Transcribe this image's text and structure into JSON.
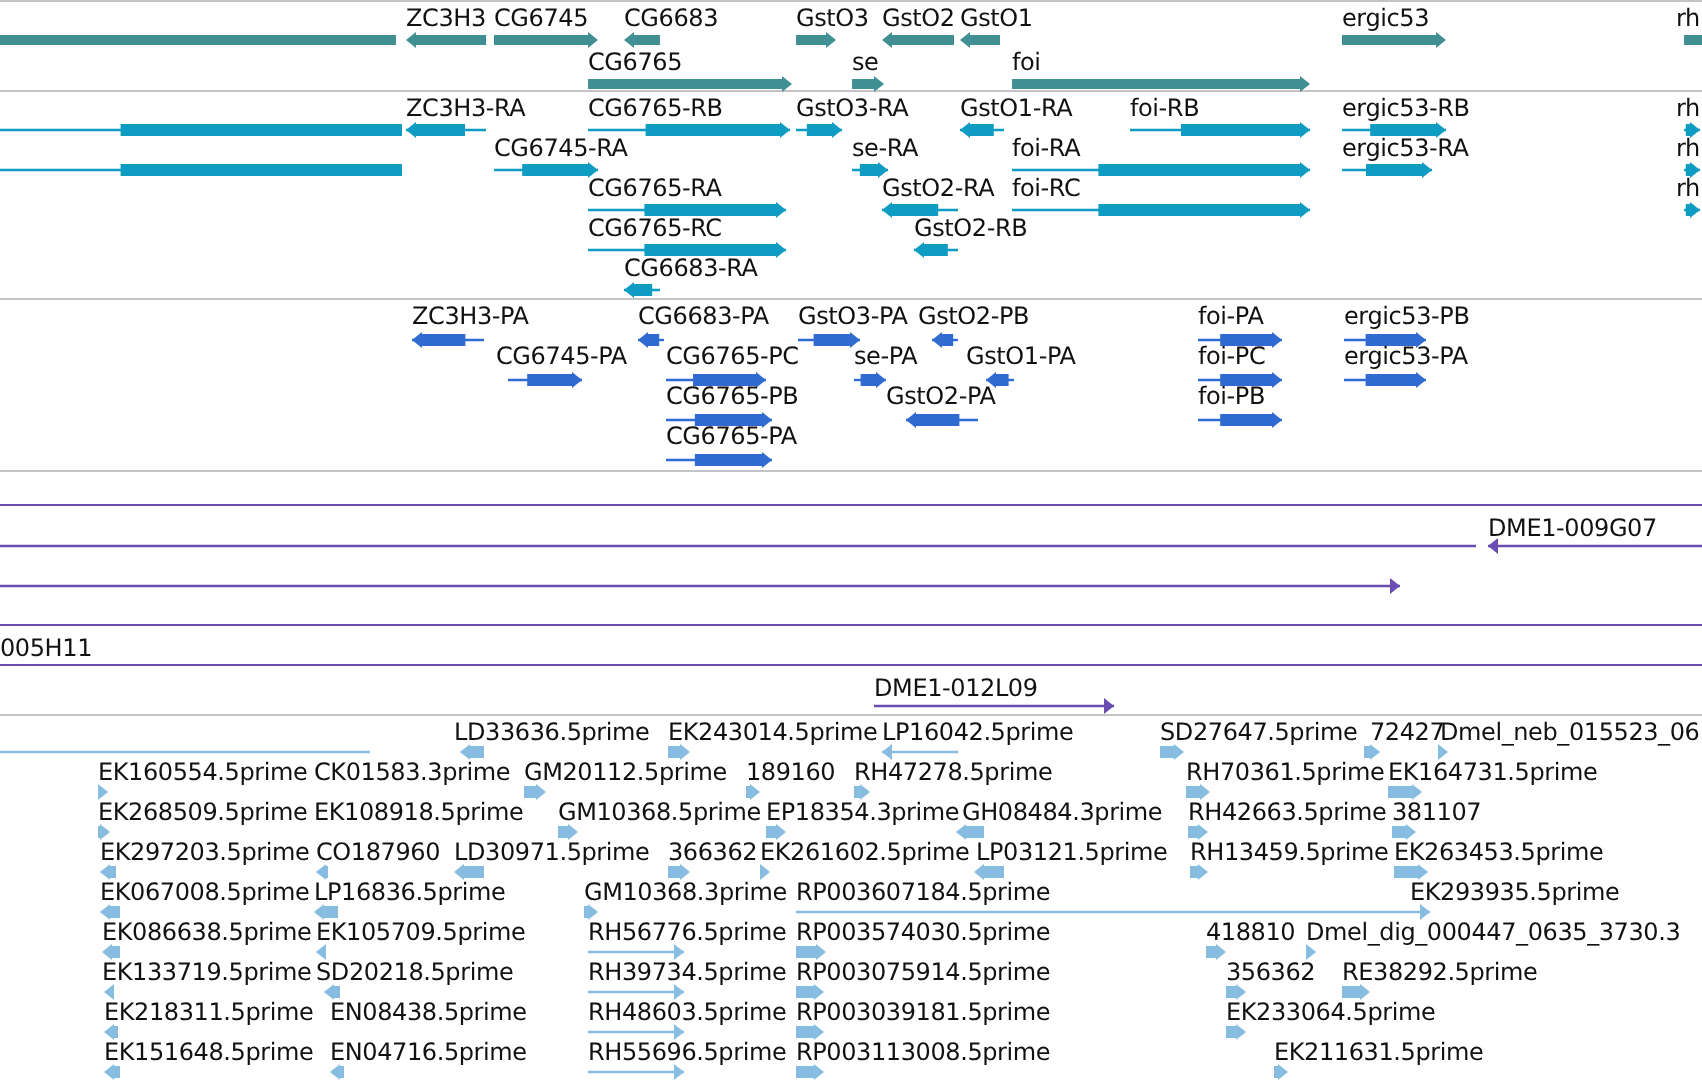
{
  "tracks": [
    {
      "kind": "gene",
      "rows": [
        {
          "features": [
            {
              "reverse": true
            },
            {
              "label": "ZC3H3",
              "reverse": true
            },
            {
              "label": "CG6745",
              "reverse": false
            },
            {
              "label": "CG6683",
              "reverse": true
            },
            {
              "label": "GstO3",
              "reverse": false
            },
            {
              "label": "GstO2",
              "reverse": true
            },
            {
              "label": "GstO1",
              "reverse": true
            },
            {
              "label": "ergic53",
              "reverse": false
            },
            {
              "label": "rh",
              "reverse": false
            }
          ]
        },
        {
          "features": [
            {
              "label": "CG6765",
              "reverse": false
            },
            {
              "label": "se",
              "reverse": false
            },
            {
              "label": "foi",
              "reverse": false
            }
          ]
        }
      ]
    },
    {
      "kind": "transcript",
      "rows": [
        {
          "features": [
            {
              "reverse": true
            },
            {
              "label": "ZC3H3-RA",
              "reverse": true
            },
            {
              "label": "CG6765-RB",
              "reverse": false
            },
            {
              "label": "GstO3-RA",
              "reverse": false
            },
            {
              "label": "GstO1-RA",
              "reverse": true
            },
            {
              "label": "foi-RB",
              "reverse": false
            },
            {
              "label": "ergic53-RB",
              "reverse": false
            },
            {
              "label": "rh",
              "reverse": false
            }
          ]
        },
        {
          "features": [
            {
              "reverse": true
            },
            {
              "label": "CG6745-RA",
              "reverse": false
            },
            {
              "label": "se-RA",
              "reverse": false
            },
            {
              "label": "foi-RA",
              "reverse": false
            },
            {
              "label": "ergic53-RA",
              "reverse": false
            },
            {
              "label": "rh",
              "reverse": false
            }
          ]
        },
        {
          "features": [
            {
              "label": "CG6765-RA",
              "reverse": false
            },
            {
              "label": "GstO2-RA",
              "reverse": true
            },
            {
              "label": "foi-RC",
              "reverse": false
            },
            {
              "label": "rh",
              "reverse": false
            }
          ]
        },
        {
          "features": [
            {
              "label": "CG6765-RC",
              "reverse": false
            },
            {
              "label": "GstO2-RB",
              "reverse": true
            }
          ]
        },
        {
          "features": [
            {
              "label": "CG6683-RA",
              "reverse": true
            }
          ]
        }
      ]
    },
    {
      "kind": "protein",
      "rows": [
        {
          "features": [
            {
              "label": "ZC3H3-PA",
              "reverse": true
            },
            {
              "label": "CG6683-PA",
              "reverse": true
            },
            {
              "label": "GstO3-PA",
              "reverse": false
            },
            {
              "label": "GstO2-PB",
              "reverse": true
            },
            {
              "label": "foi-PA",
              "reverse": false
            },
            {
              "label": "ergic53-PB",
              "reverse": false
            }
          ]
        },
        {
          "features": [
            {
              "label": "CG6745-PA",
              "reverse": false
            },
            {
              "label": "CG6765-PC",
              "reverse": false
            },
            {
              "label": "se-PA",
              "reverse": false
            },
            {
              "label": "GstO1-PA",
              "reverse": true
            },
            {
              "label": "foi-PC",
              "reverse": false
            },
            {
              "label": "ergic53-PA",
              "reverse": false
            }
          ]
        },
        {
          "features": [
            {
              "label": "CG6765-PB",
              "reverse": false
            },
            {
              "label": "GstO2-PA",
              "reverse": true
            },
            {
              "label": "foi-PB",
              "reverse": false
            }
          ]
        },
        {
          "features": [
            {
              "label": "CG6765-PA",
              "reverse": false
            }
          ]
        }
      ]
    },
    {
      "kind": "clone",
      "rows": [
        {
          "spanning": true
        },
        {
          "spanning": false,
          "features": [
            {
              "reverse": true
            },
            {
              "label": "DME1-009G07",
              "reverse": true
            }
          ]
        },
        {
          "spanning": false,
          "features": [
            {
              "reverse": false
            }
          ]
        },
        {
          "spanning": true
        },
        {
          "spanning": true,
          "features": [
            {
              "label": "005H11"
            }
          ]
        },
        {
          "spanning": false,
          "features": [
            {
              "label": "DME1-012L09",
              "reverse": false
            }
          ]
        }
      ]
    },
    {
      "kind": "est",
      "rows": [
        {
          "features": [
            {
              "reverse": true
            },
            {
              "label": "LD33636.5prime",
              "reverse": true
            },
            {
              "label": "EK243014.5prime",
              "reverse": false
            },
            {
              "label": "LP16042.5prime",
              "reverse": true
            },
            {
              "label": "SD27647.5prime",
              "reverse": false
            },
            {
              "label": "72427",
              "reverse": false
            },
            {
              "label": "Dmel_neb_015523_06",
              "reverse": false
            }
          ]
        },
        {
          "features": [
            {
              "label": "EK160554.5prime",
              "reverse": false
            },
            {
              "label": "CK01583.3prime"
            },
            {
              "label": "GM20112.5prime",
              "reverse": false
            },
            {
              "label": "189160",
              "reverse": false
            },
            {
              "label": "RH47278.5prime",
              "reverse": false
            },
            {
              "label": "RH70361.5prime",
              "reverse": false
            },
            {
              "label": "EK164731.5prime",
              "reverse": false
            }
          ]
        },
        {
          "features": [
            {
              "label": "EK268509.5prime",
              "reverse": false
            },
            {
              "label": "EK108918.5prime"
            },
            {
              "label": "GM10368.5prime",
              "reverse": false
            },
            {
              "label": "EP18354.3prime",
              "reverse": false
            },
            {
              "label": "GH08484.3prime",
              "reverse": true
            },
            {
              "label": "RH42663.5prime",
              "reverse": false
            },
            {
              "label": "381107",
              "reverse": false
            }
          ]
        },
        {
          "features": [
            {
              "label": "EK297203.5prime",
              "reverse": true
            },
            {
              "label": "CO187960",
              "reverse": true
            },
            {
              "label": "LD30971.5prime",
              "reverse": true
            },
            {
              "label": "366362",
              "reverse": false
            },
            {
              "label": "EK261602.5prime",
              "reverse": false
            },
            {
              "label": "LP03121.5prime",
              "reverse": true
            },
            {
              "label": "RH13459.5prime",
              "reverse": false
            },
            {
              "label": "EK263453.5prime",
              "reverse": false
            }
          ]
        },
        {
          "features": [
            {
              "label": "EK067008.5prime",
              "reverse": true
            },
            {
              "label": "LP16836.5prime",
              "reverse": true
            },
            {
              "label": "GM10368.3prime",
              "reverse": false
            },
            {
              "label": "RP003607184.5prime",
              "reverse": false
            },
            {
              "label": "EK293935.5prime"
            }
          ]
        },
        {
          "features": [
            {
              "label": "EK086638.5prime",
              "reverse": true
            },
            {
              "label": "EK105709.5prime",
              "reverse": true
            },
            {
              "label": "RH56776.5prime",
              "reverse": false
            },
            {
              "label": "RP003574030.5prime",
              "reverse": false
            },
            {
              "label": "418810",
              "reverse": false
            },
            {
              "label": "Dmel_dig_000447_0635_3730.3",
              "reverse": false
            }
          ]
        },
        {
          "features": [
            {
              "label": "EK133719.5prime",
              "reverse": true
            },
            {
              "label": "SD20218.5prime",
              "reverse": true
            },
            {
              "label": "RH39734.5prime",
              "reverse": false
            },
            {
              "label": "RP003075914.5prime",
              "reverse": false
            },
            {
              "label": "356362",
              "reverse": false
            },
            {
              "label": "RE38292.5prime",
              "reverse": false
            }
          ]
        },
        {
          "features": [
            {
              "label": "EK218311.5prime",
              "reverse": true
            },
            {
              "label": "EN08438.5prime"
            },
            {
              "label": "RH48603.5prime",
              "reverse": false
            },
            {
              "label": "RP003039181.5prime",
              "reverse": false
            },
            {
              "label": "EK233064.5prime",
              "reverse": false
            }
          ]
        },
        {
          "features": [
            {
              "label": "EK151648.5prime",
              "reverse": true
            },
            {
              "label": "EN04716.5prime",
              "reverse": true
            },
            {
              "label": "RH55696.5prime",
              "reverse": false
            },
            {
              "label": "RP003113008.5prime",
              "reverse": false
            },
            {
              "label": "EK211631.5prime",
              "reverse": false
            }
          ]
        }
      ]
    }
  ]
}
